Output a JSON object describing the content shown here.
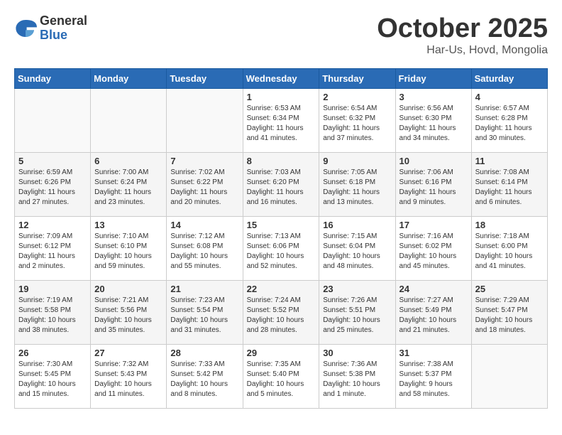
{
  "header": {
    "logo_general": "General",
    "logo_blue": "Blue",
    "month": "October 2025",
    "location": "Har-Us, Hovd, Mongolia"
  },
  "weekdays": [
    "Sunday",
    "Monday",
    "Tuesday",
    "Wednesday",
    "Thursday",
    "Friday",
    "Saturday"
  ],
  "weeks": [
    [
      {
        "day": "",
        "info": ""
      },
      {
        "day": "",
        "info": ""
      },
      {
        "day": "",
        "info": ""
      },
      {
        "day": "1",
        "info": "Sunrise: 6:53 AM\nSunset: 6:34 PM\nDaylight: 11 hours\nand 41 minutes."
      },
      {
        "day": "2",
        "info": "Sunrise: 6:54 AM\nSunset: 6:32 PM\nDaylight: 11 hours\nand 37 minutes."
      },
      {
        "day": "3",
        "info": "Sunrise: 6:56 AM\nSunset: 6:30 PM\nDaylight: 11 hours\nand 34 minutes."
      },
      {
        "day": "4",
        "info": "Sunrise: 6:57 AM\nSunset: 6:28 PM\nDaylight: 11 hours\nand 30 minutes."
      }
    ],
    [
      {
        "day": "5",
        "info": "Sunrise: 6:59 AM\nSunset: 6:26 PM\nDaylight: 11 hours\nand 27 minutes."
      },
      {
        "day": "6",
        "info": "Sunrise: 7:00 AM\nSunset: 6:24 PM\nDaylight: 11 hours\nand 23 minutes."
      },
      {
        "day": "7",
        "info": "Sunrise: 7:02 AM\nSunset: 6:22 PM\nDaylight: 11 hours\nand 20 minutes."
      },
      {
        "day": "8",
        "info": "Sunrise: 7:03 AM\nSunset: 6:20 PM\nDaylight: 11 hours\nand 16 minutes."
      },
      {
        "day": "9",
        "info": "Sunrise: 7:05 AM\nSunset: 6:18 PM\nDaylight: 11 hours\nand 13 minutes."
      },
      {
        "day": "10",
        "info": "Sunrise: 7:06 AM\nSunset: 6:16 PM\nDaylight: 11 hours\nand 9 minutes."
      },
      {
        "day": "11",
        "info": "Sunrise: 7:08 AM\nSunset: 6:14 PM\nDaylight: 11 hours\nand 6 minutes."
      }
    ],
    [
      {
        "day": "12",
        "info": "Sunrise: 7:09 AM\nSunset: 6:12 PM\nDaylight: 11 hours\nand 2 minutes."
      },
      {
        "day": "13",
        "info": "Sunrise: 7:10 AM\nSunset: 6:10 PM\nDaylight: 10 hours\nand 59 minutes."
      },
      {
        "day": "14",
        "info": "Sunrise: 7:12 AM\nSunset: 6:08 PM\nDaylight: 10 hours\nand 55 minutes."
      },
      {
        "day": "15",
        "info": "Sunrise: 7:13 AM\nSunset: 6:06 PM\nDaylight: 10 hours\nand 52 minutes."
      },
      {
        "day": "16",
        "info": "Sunrise: 7:15 AM\nSunset: 6:04 PM\nDaylight: 10 hours\nand 48 minutes."
      },
      {
        "day": "17",
        "info": "Sunrise: 7:16 AM\nSunset: 6:02 PM\nDaylight: 10 hours\nand 45 minutes."
      },
      {
        "day": "18",
        "info": "Sunrise: 7:18 AM\nSunset: 6:00 PM\nDaylight: 10 hours\nand 41 minutes."
      }
    ],
    [
      {
        "day": "19",
        "info": "Sunrise: 7:19 AM\nSunset: 5:58 PM\nDaylight: 10 hours\nand 38 minutes."
      },
      {
        "day": "20",
        "info": "Sunrise: 7:21 AM\nSunset: 5:56 PM\nDaylight: 10 hours\nand 35 minutes."
      },
      {
        "day": "21",
        "info": "Sunrise: 7:23 AM\nSunset: 5:54 PM\nDaylight: 10 hours\nand 31 minutes."
      },
      {
        "day": "22",
        "info": "Sunrise: 7:24 AM\nSunset: 5:52 PM\nDaylight: 10 hours\nand 28 minutes."
      },
      {
        "day": "23",
        "info": "Sunrise: 7:26 AM\nSunset: 5:51 PM\nDaylight: 10 hours\nand 25 minutes."
      },
      {
        "day": "24",
        "info": "Sunrise: 7:27 AM\nSunset: 5:49 PM\nDaylight: 10 hours\nand 21 minutes."
      },
      {
        "day": "25",
        "info": "Sunrise: 7:29 AM\nSunset: 5:47 PM\nDaylight: 10 hours\nand 18 minutes."
      }
    ],
    [
      {
        "day": "26",
        "info": "Sunrise: 7:30 AM\nSunset: 5:45 PM\nDaylight: 10 hours\nand 15 minutes."
      },
      {
        "day": "27",
        "info": "Sunrise: 7:32 AM\nSunset: 5:43 PM\nDaylight: 10 hours\nand 11 minutes."
      },
      {
        "day": "28",
        "info": "Sunrise: 7:33 AM\nSunset: 5:42 PM\nDaylight: 10 hours\nand 8 minutes."
      },
      {
        "day": "29",
        "info": "Sunrise: 7:35 AM\nSunset: 5:40 PM\nDaylight: 10 hours\nand 5 minutes."
      },
      {
        "day": "30",
        "info": "Sunrise: 7:36 AM\nSunset: 5:38 PM\nDaylight: 10 hours\nand 1 minute."
      },
      {
        "day": "31",
        "info": "Sunrise: 7:38 AM\nSunset: 5:37 PM\nDaylight: 9 hours\nand 58 minutes."
      },
      {
        "day": "",
        "info": ""
      }
    ]
  ]
}
